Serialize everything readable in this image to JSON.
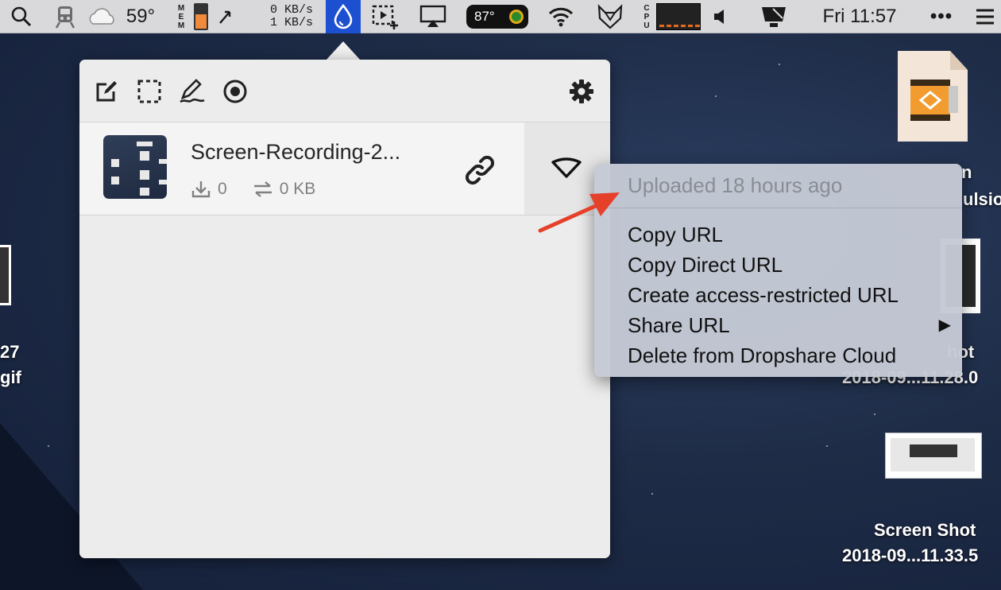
{
  "menubar": {
    "weather_temp": "59°",
    "mem_label": "MEM",
    "net_up": "0 KB/s",
    "net_down": "1 KB/s",
    "cpu_temp": "87°",
    "cpu_label": "CPU",
    "clock": "Fri 11:57",
    "more": "•••"
  },
  "popover": {
    "file": {
      "name": "Screen-Recording-2...",
      "downloads": "0",
      "transfer": "0 KB"
    }
  },
  "context_menu": {
    "header": "Uploaded 18 hours ago",
    "items": [
      {
        "label": "Copy URL"
      },
      {
        "label": "Copy Direct URL"
      },
      {
        "label": "Create access-restricted URL"
      },
      {
        "label": "Share URL",
        "submenu": "▶"
      },
      {
        "label": "Delete from Dropshare Cloud"
      }
    ]
  },
  "desktop": {
    "left_label_1": "27",
    "left_label_2": "gif",
    "right_top_label_1": "n",
    "right_top_label_2": "ulsio",
    "right_mid_label_1": "hot",
    "right_mid_label_2": "2018-09...11.28.0",
    "right_bottom_label_1": "Screen Shot",
    "right_bottom_label_2": "2018-09...11.33.5"
  },
  "colors": {
    "menubar": "#d9d9db",
    "dropshare_active": "#1d4fd1",
    "annotation_arrow": "#e5402a"
  }
}
